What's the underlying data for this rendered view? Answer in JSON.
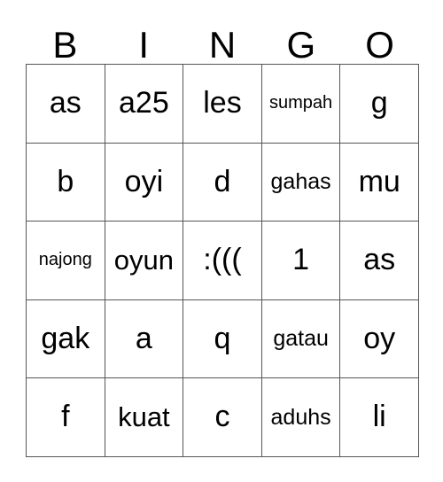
{
  "card": {
    "headers": [
      "B",
      "I",
      "N",
      "G",
      "O"
    ],
    "rows": [
      [
        {
          "text": "as",
          "size": "fs-xl"
        },
        {
          "text": "a25",
          "size": "fs-xl"
        },
        {
          "text": "les",
          "size": "fs-xl"
        },
        {
          "text": "sumpah",
          "size": "fs-sm"
        },
        {
          "text": "g",
          "size": "fs-xl"
        }
      ],
      [
        {
          "text": "b",
          "size": "fs-xl"
        },
        {
          "text": "oyi",
          "size": "fs-xl"
        },
        {
          "text": "d",
          "size": "fs-xl"
        },
        {
          "text": "gahas",
          "size": "fs-md"
        },
        {
          "text": "mu",
          "size": "fs-xl"
        }
      ],
      [
        {
          "text": "najong",
          "size": "fs-sm"
        },
        {
          "text": "oyun",
          "size": "fs-lg"
        },
        {
          "text": ":(((",
          "size": "fs-xl"
        },
        {
          "text": "1",
          "size": "fs-xl"
        },
        {
          "text": "as",
          "size": "fs-xl"
        }
      ],
      [
        {
          "text": "gak",
          "size": "fs-xl"
        },
        {
          "text": "a",
          "size": "fs-xl"
        },
        {
          "text": "q",
          "size": "fs-xl"
        },
        {
          "text": "gatau",
          "size": "fs-md"
        },
        {
          "text": "oy",
          "size": "fs-xl"
        }
      ],
      [
        {
          "text": "f",
          "size": "fs-xl"
        },
        {
          "text": "kuat",
          "size": "fs-lg"
        },
        {
          "text": "c",
          "size": "fs-xl"
        },
        {
          "text": "aduhs",
          "size": "fs-md"
        },
        {
          "text": "li",
          "size": "fs-xl"
        }
      ]
    ],
    "colors": {
      "background": "#ffffff",
      "text": "#000000",
      "grid_line": "#555555"
    }
  }
}
